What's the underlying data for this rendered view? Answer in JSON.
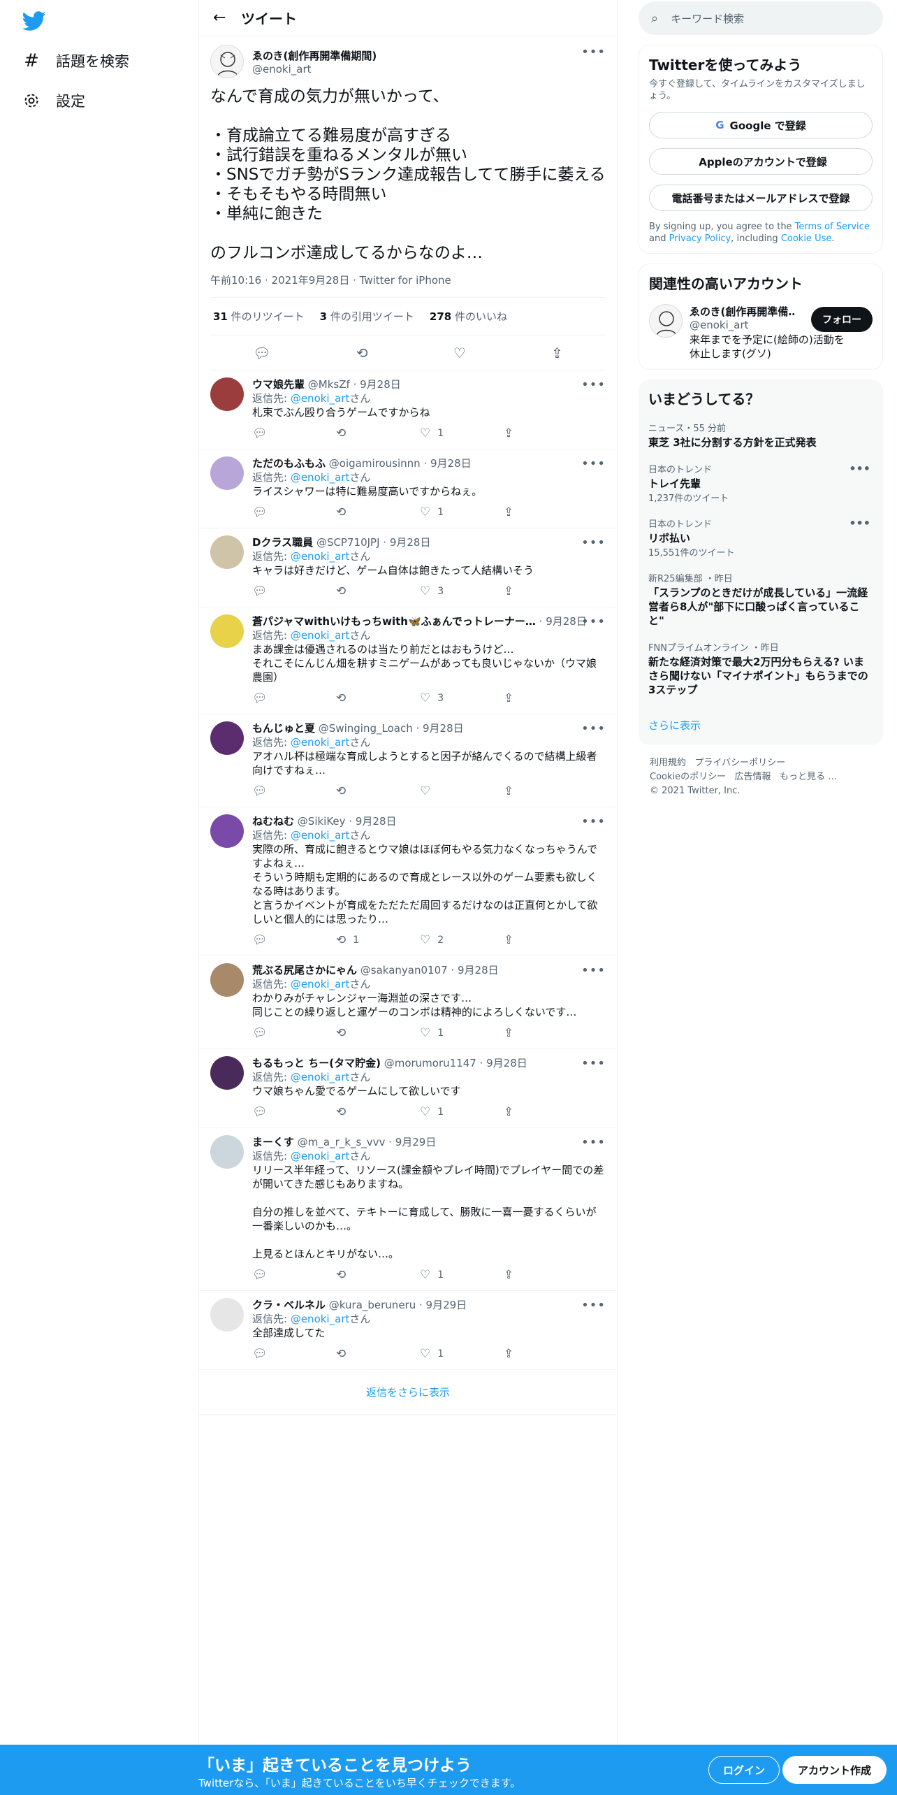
{
  "nav": {
    "explore": "話題を検索",
    "settings": "設定"
  },
  "header": {
    "title": "ツイート"
  },
  "tweet": {
    "name": "ゑのき(創作再開準備期間)",
    "handle": "@enoki_art",
    "text": "なんで育成の気力が無いかって、\n\n・育成論立てる難易度が高すぎる\n・試行錯誤を重ねるメンタルが無い\n・SNSでガチ勢がSランク達成報告してて勝手に萎える\n・そもそもやる時間無い\n・単純に飽きた\n\nのフルコンボ達成してるからなのよ…",
    "time": "午前10:16",
    "date": "2021年9月28日",
    "client": "Twitter for iPhone",
    "retweets": "31",
    "retweets_label": "件のリツイート",
    "quotes": "3",
    "quotes_label": "件の引用ツイート",
    "likes": "278",
    "likes_label": "件のいいね"
  },
  "reply_prefix": "返信先: ",
  "reply_suffix": "さん",
  "replies": [
    {
      "name": "ウマ娘先輩",
      "handle": "@MksZf",
      "date": "9月28日",
      "to": "@enoki_art",
      "text": "札束でぶん殴り合うゲームですからね",
      "rt": "",
      "like": "1",
      "avc": "#9c3d3d"
    },
    {
      "name": "ただのもふもふ",
      "handle": "@oigamirousinnn",
      "date": "9月28日",
      "to": "@enoki_art",
      "text": "ライスシャワーは特に難易度高いですからねぇ。",
      "rt": "",
      "like": "1",
      "avc": "#b9a6d8"
    },
    {
      "name": "Dクラス職員",
      "handle": "@SCP710JPJ",
      "date": "9月28日",
      "to": "@enoki_art",
      "text": "キャラは好きだけど、ゲーム自体は飽きたって人結構いそう",
      "rt": "",
      "like": "3",
      "avc": "#cfc3a8"
    },
    {
      "name": "蒼パジャマwithいけもっちwith🦋ふぁんでっトレーナー…",
      "handle": "",
      "date": "9月28日",
      "to": "@enoki_art",
      "text": "まあ課金は優遇されるのは当たり前だとはおもうけど…\nそれこそにんじん畑を耕すミニゲームがあっても良いじゃないか（ウマ娘農園）",
      "rt": "",
      "like": "3",
      "avc": "#e8d24a"
    },
    {
      "name": "もんじゅと夏",
      "handle": "@Swinging_Loach",
      "date": "9月28日",
      "to": "@enoki_art",
      "text": "アオハル杯は極端な育成しようとすると因子が絡んでくるので結構上級者向けですねぇ…",
      "rt": "",
      "like": "",
      "avc": "#5b2d6e"
    },
    {
      "name": "ねむねむ",
      "handle": "@SikiKey",
      "date": "9月28日",
      "to": "@enoki_art",
      "text": "実際の所、育成に飽きるとウマ娘はほぼ何もやる気力なくなっちゃうんですよねぇ…\nそういう時期も定期的にあるので育成とレース以外のゲーム要素も欲しくなる時はあります。\nと言うかイベントが育成をただただ周回するだけなのは正直何とかして欲しいと個人的には思ったり…",
      "rt": "1",
      "like": "2",
      "avc": "#7a4aa8"
    },
    {
      "name": "荒ぶる尻尾さかにゃん",
      "handle": "@sakanyan0107",
      "date": "9月28日",
      "to": "@enoki_art",
      "text": "わかりみがチャレンジャー海淵並の深さです…\n同じことの繰り返しと運ゲーのコンボは精神的によろしくないです…",
      "rt": "",
      "like": "1",
      "avc": "#a88a6a"
    },
    {
      "name": "もるもっと ちー(タマ貯金)",
      "handle": "@morumoru1147",
      "date": "9月28日",
      "to": "@enoki_art",
      "text": "ウマ娘ちゃん愛でるゲームにして欲しいです",
      "rt": "",
      "like": "1",
      "avc": "#4a2a5a"
    },
    {
      "name": "まーくす",
      "handle": "@m_a_r_k_s_vvv",
      "date": "9月29日",
      "to": "@enoki_art",
      "text": "リリース半年経って、リソース(課金額やプレイ時間)でプレイヤー間での差が開いてきた感じもありますね。\n\n自分の推しを並べて、テキトーに育成して、勝敗に一喜一憂するくらいが一番楽しいのかも…。\n\n上見るとほんとキリがない…。",
      "rt": "",
      "like": "1",
      "avc": "#ccd6dd"
    },
    {
      "name": "クラ・ベルネル",
      "handle": "@kura_beruneru",
      "date": "9月29日",
      "to": "@enoki_art",
      "text": "全部達成してた",
      "rt": "",
      "like": "1",
      "avc": "#e6e6e6"
    }
  ],
  "show_more_replies": "返信をさらに表示",
  "search": {
    "placeholder": "キーワード検索"
  },
  "signup": {
    "title": "Twitterを使ってみよう",
    "subtitle": "今すぐ登録して、タイムラインをカスタマイズしましょう。",
    "google": "Google で登録",
    "apple": "Appleのアカウントで登録",
    "phone": "電話番号またはメールアドレスで登録",
    "legal_pre": "By signing up, you agree to the ",
    "tos": "Terms of Service",
    "and": " and ",
    "privacy": "Privacy Policy",
    "including": ", including ",
    "cookie": "Cookie Use",
    "dot": "."
  },
  "relevant": {
    "title": "関連性の高いアカウント",
    "name": "ゑのき(創作再開準備…",
    "handle": "@enoki_art",
    "bio": "来年までを予定に(絵師の)活動を休止します(グソ)",
    "follow": "フォロー"
  },
  "trends": {
    "title": "いまどうしてる？",
    "items": [
      {
        "meta": "ニュース・55 分前",
        "title": "東芝 3社に分割する方針を正式発表",
        "sub": ""
      },
      {
        "meta": "日本のトレンド",
        "title": "トレイ先輩",
        "sub": "1,237件のツイート"
      },
      {
        "meta": "日本のトレンド",
        "title": "リボ払い",
        "sub": "15,551件のツイート"
      },
      {
        "meta": "新R25編集部 ・昨日",
        "title": "「スランプのときだけが成長している」一流経営者ら8人が\"部下に口酸っぱく言っていること\"",
        "sub": ""
      },
      {
        "meta": "FNNプライムオンライン ・昨日",
        "title": "新たな経済対策で最大2万円分もらえる? いまさら聞けない「マイナポイント」もらうまでの3ステップ",
        "sub": ""
      }
    ],
    "show_all": "さらに表示"
  },
  "footer": {
    "terms": "利用規約",
    "privacy": "プライバシーポリシー",
    "cookie": "Cookieのポリシー",
    "ads": "広告情報",
    "more": "もっと見る …",
    "copy": "© 2021 Twitter, Inc."
  },
  "banner": {
    "title": "「いま」起きていることを見つけよう",
    "sub": "Twitterなら、「いま」起きていることをいち早くチェックできます。",
    "login": "ログイン",
    "signup": "アカウント作成"
  },
  "colors": {
    "accent": "#1d9bf0",
    "text": "#0f1419",
    "gray": "#536471"
  }
}
